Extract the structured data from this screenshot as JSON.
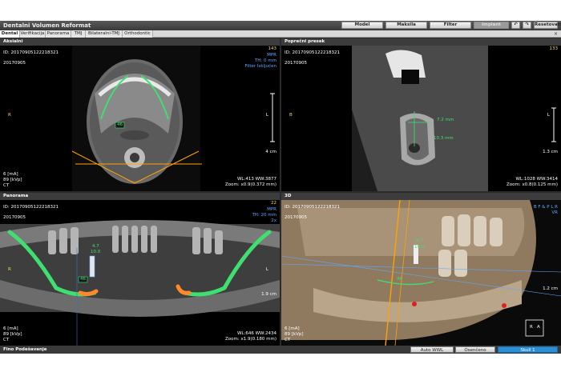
{
  "window": {
    "title": "Dentalni Volumen Reformat",
    "buttons": {
      "model": "Model",
      "maksila": "Maksila",
      "filter": "Filter",
      "implant": "Implant",
      "reset": "Resetovati"
    }
  },
  "tabs": [
    "Dental",
    "Verifikacija",
    "Panorama",
    "TMJ",
    "Bilateralni-TMJ",
    "Orthodontic"
  ],
  "tabs_close": "×",
  "panels": {
    "axial": {
      "title": "Aksialni",
      "id": "ID: 20170905122218321",
      "date": "20170905",
      "slice": "143",
      "mode": "MPR",
      "thickness": "TH: 0 mm",
      "filter": "Filter Isključen",
      "left_marker": "R",
      "right_marker": "L",
      "scale": "4 cm",
      "ma": "6 [mA]",
      "kvp": "89 [kVp]",
      "modality": "CT",
      "wlww": "WL:413 WW:3877",
      "zoom": "Zoom: x0.9(0.372 mm)",
      "canal_label": "46"
    },
    "cross": {
      "title": "Poprečni presek",
      "id": "ID: 20170905122218321",
      "date": "20170905",
      "slice": "133",
      "left_marker": "B",
      "right_marker": "L",
      "scale": "1.3 cm",
      "meas1": "7.2 mm",
      "meas2": "10.3 mm",
      "wlww": "WL:1028 WW:3414",
      "zoom": "Zoom: x0.8(0.125 mm)"
    },
    "panorama": {
      "title": "Panorama",
      "id": "ID: 20170905122218321",
      "date": "20170905",
      "slice": "22",
      "mode": "MPR",
      "thickness": "TH: 20 mm",
      "zoom_factor": "2x",
      "left_marker": "R",
      "right_marker": "L",
      "scale": "1.9 cm",
      "implant_label_1": "4.7",
      "implant_label_2": "10.0",
      "canal_label": "46",
      "ma": "6 [mA]",
      "kvp": "89 [kVp]",
      "modality": "CT",
      "wlww": "WL:646 WW:2434",
      "zoom": "Zoom: x1.9(0.180 mm)"
    },
    "volume": {
      "title": "3D",
      "id": "ID: 20170905122218321",
      "date": "20170905",
      "orientation": "B F & P L R",
      "mode": "VR",
      "scale": "1.2 cm",
      "implant_label_1": "4.7",
      "implant_label_2": "10.0",
      "canal_label": "46",
      "ma": "6 [mA]",
      "kvp": "89 [kVp]",
      "modality": "CT",
      "cube_r": "R",
      "cube_a": "A"
    }
  },
  "bottombar": {
    "label": "Fino Podešavanje",
    "auto_wwl": "Auto WWL",
    "osenceno": "Osenčeno",
    "skull": "Skull 1"
  },
  "colors": {
    "canal": "#3fe070",
    "canal_end": "#ff8a2a",
    "cursor": "#ffa200",
    "overlay_blue": "#5fa8ff"
  }
}
